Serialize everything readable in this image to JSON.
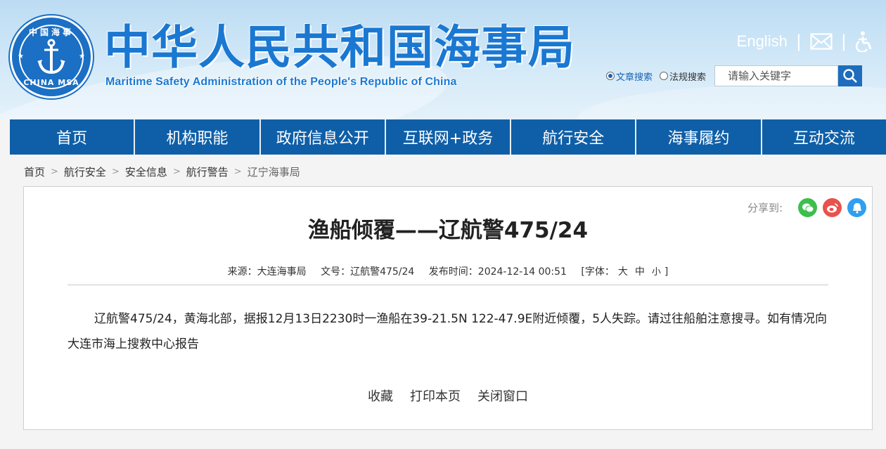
{
  "header": {
    "emblem_top_text": "中国海事",
    "emblem_bottom_text": "CHINA MSA",
    "title_cn": "中华人民共和国海事局",
    "title_en": "Maritime Safety Administration of the People's Republic of China",
    "english_link": "English",
    "separator": "|"
  },
  "search": {
    "option_article": "文章搜索",
    "option_law": "法规搜索",
    "placeholder": "请输入关键字"
  },
  "nav": [
    "首页",
    "机构职能",
    "政府信息公开",
    "互联网+政务",
    "航行安全",
    "海事履约",
    "互动交流"
  ],
  "breadcrumb": [
    "首页",
    "航行安全",
    "安全信息",
    "航行警告",
    "辽宁海事局"
  ],
  "breadcrumb_separator": ">",
  "article": {
    "share_label": "分享到:",
    "title": "渔船倾覆——辽航警475/24",
    "source": "来源：大连海事局",
    "doc_no": "文号：辽航警475/24",
    "published": "发布时间：2024-12-14 00:51",
    "font_size_label": "[字体：",
    "font_large": "大",
    "font_medium": "中",
    "font_small": "小",
    "font_close": "]",
    "body": "辽航警475/24，黄海北部，据报12月13日2230时一渔船在39-21.5N 122-47.9E附近倾覆，5人失踪。请过往船舶注意搜寻。如有情况向大连市海上搜救中心报告",
    "actions": [
      "收藏",
      "打印本页",
      "关闭窗口"
    ]
  },
  "colors": {
    "brand_blue": "#1a78d2",
    "nav_blue": "#0f5fa8",
    "wechat_green": "#3cbf4b",
    "weibo_red": "#e8524c",
    "qq_blue": "#2f9ff0"
  }
}
